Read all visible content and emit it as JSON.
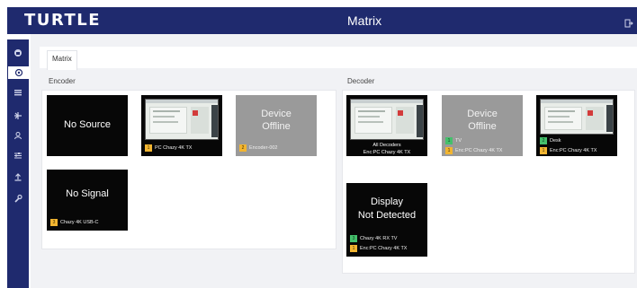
{
  "topbar": {
    "logo": "TURTLE",
    "title": "Matrix",
    "logout_icon": "logout-icon"
  },
  "sidebar": {
    "icons": [
      "home-icon",
      "settings-icon",
      "menu-icon",
      "network-icon",
      "user-icon",
      "sliders-icon",
      "upload-icon",
      "wrench-icon"
    ]
  },
  "tabs": [
    {
      "label": "Matrix"
    }
  ],
  "colors": {
    "nav": "#1f2a6e",
    "badge_yellow": "#f2b531",
    "badge_green": "#45c06c",
    "offline_gray": "#9a9a9a"
  },
  "encoder": {
    "section_label": "Encoder",
    "tiles": [
      {
        "status_text": "No Source"
      },
      {
        "badge": "1",
        "label": "PC Chazy 4K TX"
      },
      {
        "status_line1": "Device",
        "status_line2": "Offline",
        "badge": "2",
        "label": "Encoder-002"
      },
      {
        "status_text": "No Signal",
        "badge": "3",
        "label": "Chazy 4K USB-C"
      }
    ]
  },
  "decoder": {
    "section_label": "Decoder",
    "tiles": [
      {
        "line1": "All Decoders",
        "line2": "Enc:PC Chazy 4K TX"
      },
      {
        "status_line1": "Device",
        "status_line2": "Offline",
        "badge_green": "1",
        "label_green": "TV",
        "badge_yellow": "1",
        "label_yellow": "Enc:PC Chazy 4K TX"
      },
      {
        "badge_green": "2",
        "label_green": "Desk",
        "badge_yellow": "1",
        "label_yellow": "Enc:PC Chazy 4K TX"
      },
      {
        "status_line1": "Display",
        "status_line2": "Not Detected",
        "badge_green": "3",
        "label_green": "Chazy 4K RX TV",
        "badge_yellow": "1",
        "label_yellow": "Enc:PC Chazy 4K TX"
      }
    ]
  }
}
